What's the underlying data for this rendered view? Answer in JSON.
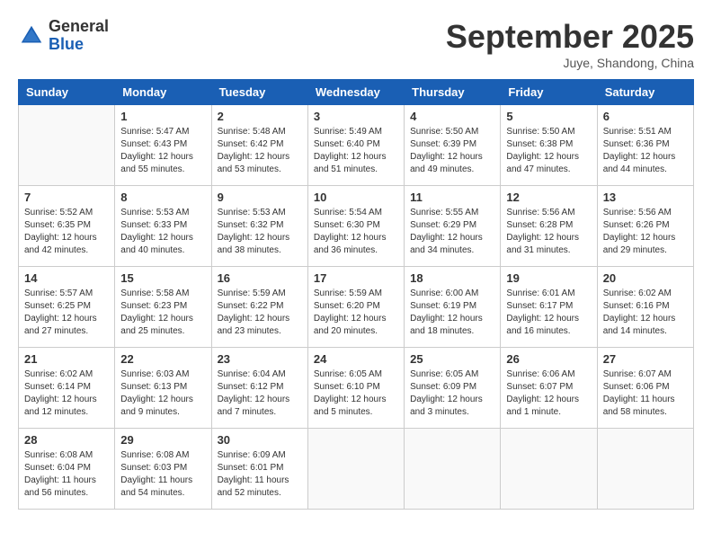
{
  "header": {
    "logo_general": "General",
    "logo_blue": "Blue",
    "title": "September 2025",
    "location": "Juye, Shandong, China"
  },
  "days_of_week": [
    "Sunday",
    "Monday",
    "Tuesday",
    "Wednesday",
    "Thursday",
    "Friday",
    "Saturday"
  ],
  "weeks": [
    [
      {
        "day": "",
        "info": ""
      },
      {
        "day": "1",
        "info": "Sunrise: 5:47 AM\nSunset: 6:43 PM\nDaylight: 12 hours\nand 55 minutes."
      },
      {
        "day": "2",
        "info": "Sunrise: 5:48 AM\nSunset: 6:42 PM\nDaylight: 12 hours\nand 53 minutes."
      },
      {
        "day": "3",
        "info": "Sunrise: 5:49 AM\nSunset: 6:40 PM\nDaylight: 12 hours\nand 51 minutes."
      },
      {
        "day": "4",
        "info": "Sunrise: 5:50 AM\nSunset: 6:39 PM\nDaylight: 12 hours\nand 49 minutes."
      },
      {
        "day": "5",
        "info": "Sunrise: 5:50 AM\nSunset: 6:38 PM\nDaylight: 12 hours\nand 47 minutes."
      },
      {
        "day": "6",
        "info": "Sunrise: 5:51 AM\nSunset: 6:36 PM\nDaylight: 12 hours\nand 44 minutes."
      }
    ],
    [
      {
        "day": "7",
        "info": "Sunrise: 5:52 AM\nSunset: 6:35 PM\nDaylight: 12 hours\nand 42 minutes."
      },
      {
        "day": "8",
        "info": "Sunrise: 5:53 AM\nSunset: 6:33 PM\nDaylight: 12 hours\nand 40 minutes."
      },
      {
        "day": "9",
        "info": "Sunrise: 5:53 AM\nSunset: 6:32 PM\nDaylight: 12 hours\nand 38 minutes."
      },
      {
        "day": "10",
        "info": "Sunrise: 5:54 AM\nSunset: 6:30 PM\nDaylight: 12 hours\nand 36 minutes."
      },
      {
        "day": "11",
        "info": "Sunrise: 5:55 AM\nSunset: 6:29 PM\nDaylight: 12 hours\nand 34 minutes."
      },
      {
        "day": "12",
        "info": "Sunrise: 5:56 AM\nSunset: 6:28 PM\nDaylight: 12 hours\nand 31 minutes."
      },
      {
        "day": "13",
        "info": "Sunrise: 5:56 AM\nSunset: 6:26 PM\nDaylight: 12 hours\nand 29 minutes."
      }
    ],
    [
      {
        "day": "14",
        "info": "Sunrise: 5:57 AM\nSunset: 6:25 PM\nDaylight: 12 hours\nand 27 minutes."
      },
      {
        "day": "15",
        "info": "Sunrise: 5:58 AM\nSunset: 6:23 PM\nDaylight: 12 hours\nand 25 minutes."
      },
      {
        "day": "16",
        "info": "Sunrise: 5:59 AM\nSunset: 6:22 PM\nDaylight: 12 hours\nand 23 minutes."
      },
      {
        "day": "17",
        "info": "Sunrise: 5:59 AM\nSunset: 6:20 PM\nDaylight: 12 hours\nand 20 minutes."
      },
      {
        "day": "18",
        "info": "Sunrise: 6:00 AM\nSunset: 6:19 PM\nDaylight: 12 hours\nand 18 minutes."
      },
      {
        "day": "19",
        "info": "Sunrise: 6:01 AM\nSunset: 6:17 PM\nDaylight: 12 hours\nand 16 minutes."
      },
      {
        "day": "20",
        "info": "Sunrise: 6:02 AM\nSunset: 6:16 PM\nDaylight: 12 hours\nand 14 minutes."
      }
    ],
    [
      {
        "day": "21",
        "info": "Sunrise: 6:02 AM\nSunset: 6:14 PM\nDaylight: 12 hours\nand 12 minutes."
      },
      {
        "day": "22",
        "info": "Sunrise: 6:03 AM\nSunset: 6:13 PM\nDaylight: 12 hours\nand 9 minutes."
      },
      {
        "day": "23",
        "info": "Sunrise: 6:04 AM\nSunset: 6:12 PM\nDaylight: 12 hours\nand 7 minutes."
      },
      {
        "day": "24",
        "info": "Sunrise: 6:05 AM\nSunset: 6:10 PM\nDaylight: 12 hours\nand 5 minutes."
      },
      {
        "day": "25",
        "info": "Sunrise: 6:05 AM\nSunset: 6:09 PM\nDaylight: 12 hours\nand 3 minutes."
      },
      {
        "day": "26",
        "info": "Sunrise: 6:06 AM\nSunset: 6:07 PM\nDaylight: 12 hours\nand 1 minute."
      },
      {
        "day": "27",
        "info": "Sunrise: 6:07 AM\nSunset: 6:06 PM\nDaylight: 11 hours\nand 58 minutes."
      }
    ],
    [
      {
        "day": "28",
        "info": "Sunrise: 6:08 AM\nSunset: 6:04 PM\nDaylight: 11 hours\nand 56 minutes."
      },
      {
        "day": "29",
        "info": "Sunrise: 6:08 AM\nSunset: 6:03 PM\nDaylight: 11 hours\nand 54 minutes."
      },
      {
        "day": "30",
        "info": "Sunrise: 6:09 AM\nSunset: 6:01 PM\nDaylight: 11 hours\nand 52 minutes."
      },
      {
        "day": "",
        "info": ""
      },
      {
        "day": "",
        "info": ""
      },
      {
        "day": "",
        "info": ""
      },
      {
        "day": "",
        "info": ""
      }
    ]
  ]
}
